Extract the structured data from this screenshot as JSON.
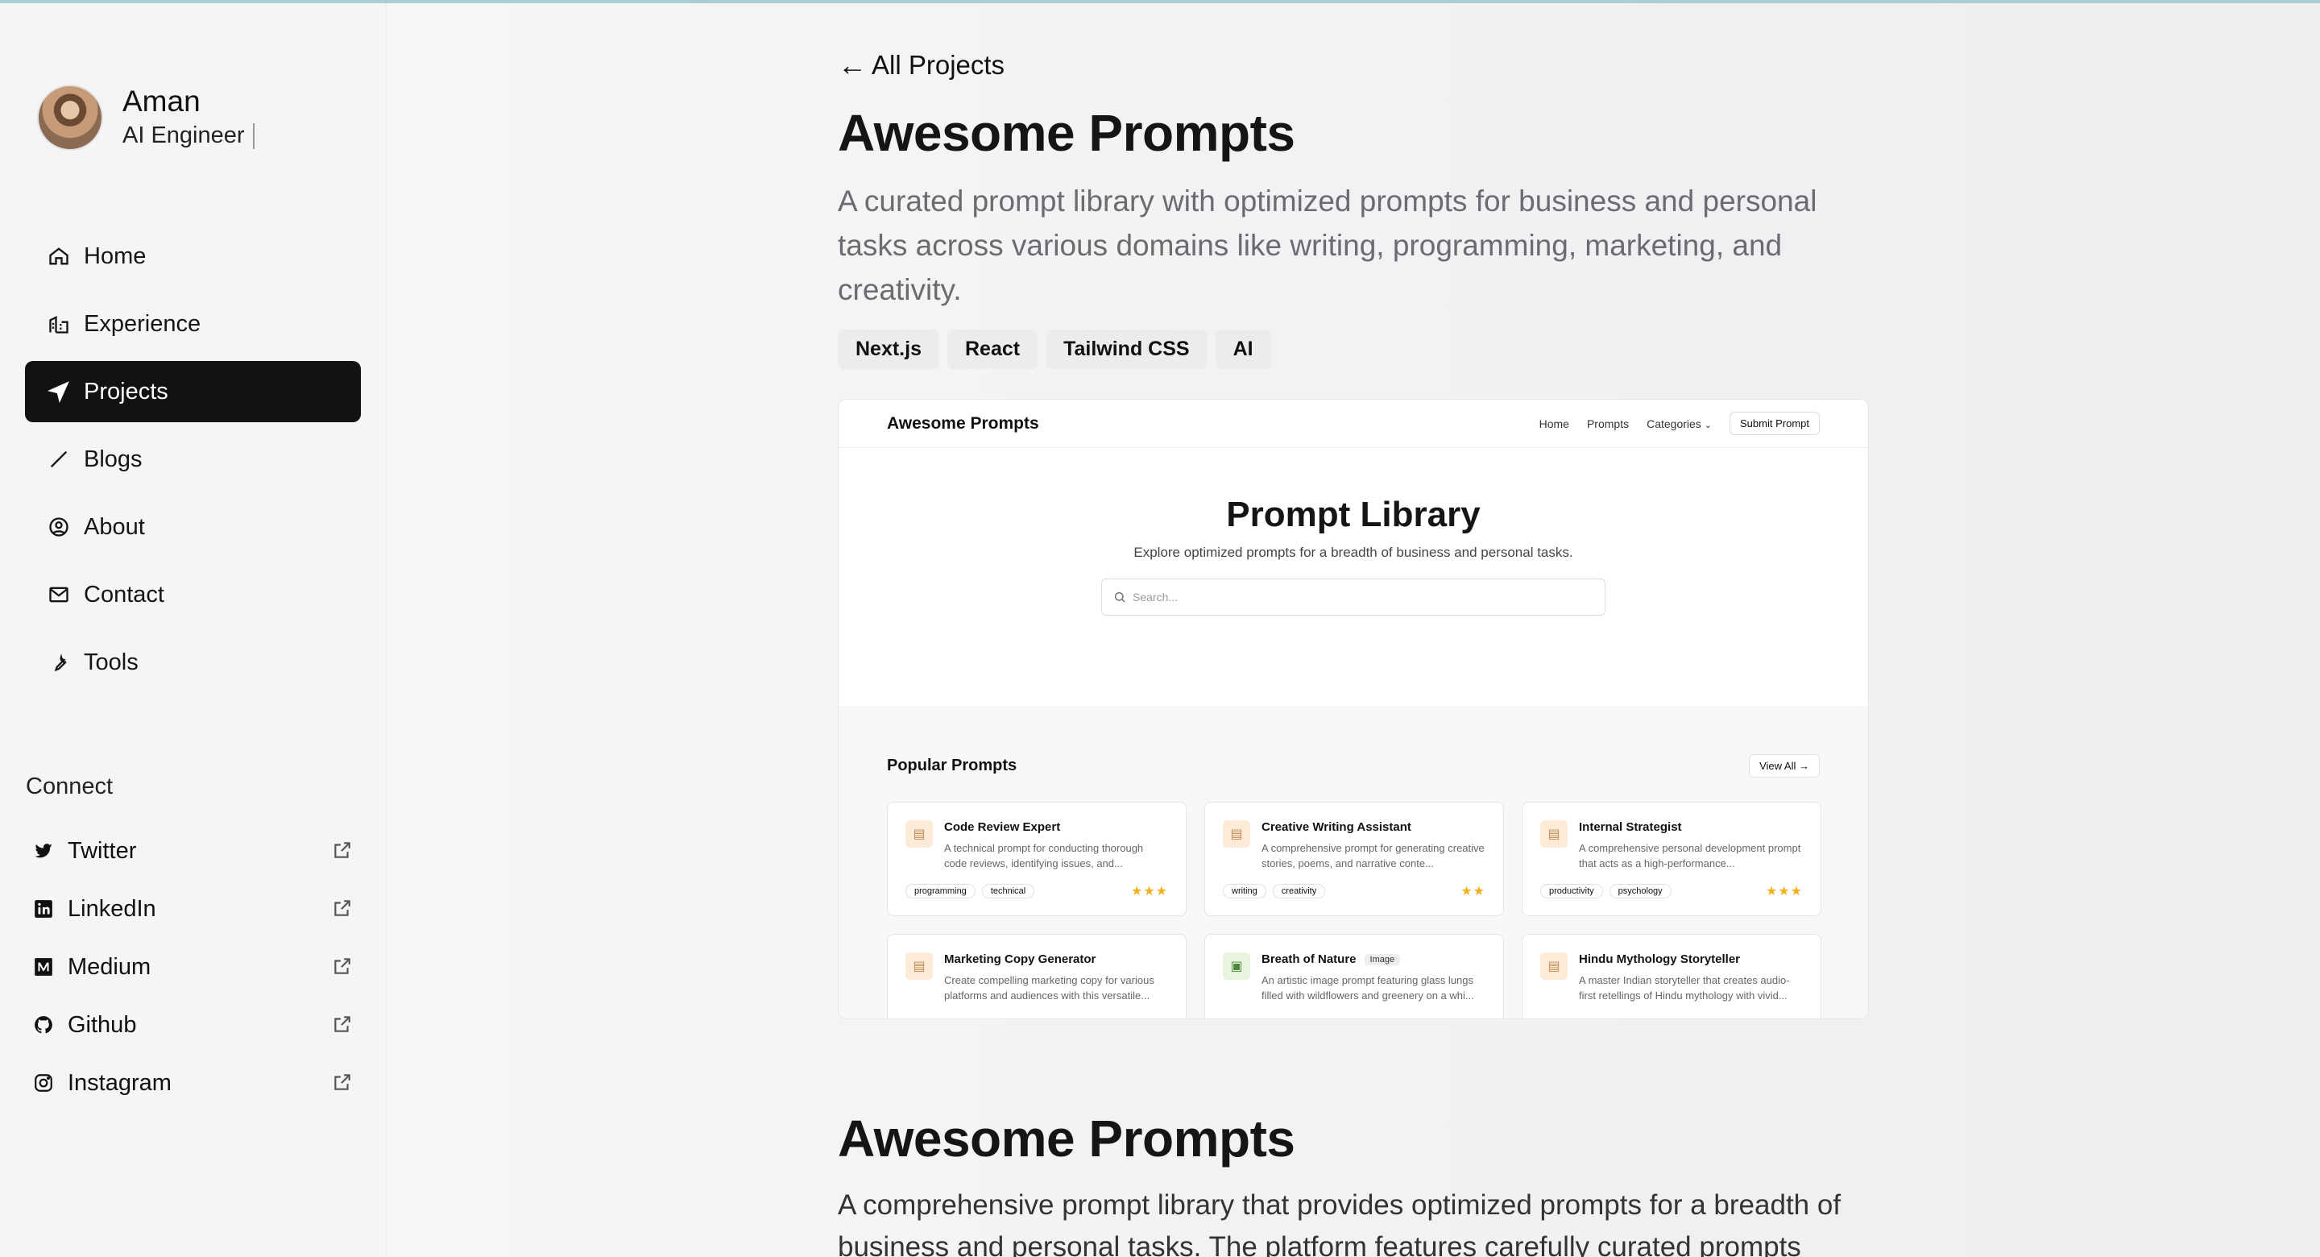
{
  "profile": {
    "name": "Aman",
    "role": "AI Engineer"
  },
  "nav": [
    {
      "label": "Home",
      "icon": "home-icon"
    },
    {
      "label": "Experience",
      "icon": "building-icon"
    },
    {
      "label": "Projects",
      "icon": "navigation-icon",
      "active": true
    },
    {
      "label": "Blogs",
      "icon": "pen-icon"
    },
    {
      "label": "About",
      "icon": "user-circle-icon"
    },
    {
      "label": "Contact",
      "icon": "mail-icon"
    },
    {
      "label": "Tools",
      "icon": "wrench-icon"
    }
  ],
  "connect": {
    "title": "Connect",
    "items": [
      {
        "label": "Twitter",
        "icon": "twitter-icon"
      },
      {
        "label": "LinkedIn",
        "icon": "linkedin-icon"
      },
      {
        "label": "Medium",
        "icon": "medium-icon"
      },
      {
        "label": "Github",
        "icon": "github-icon"
      },
      {
        "label": "Instagram",
        "icon": "instagram-icon"
      }
    ]
  },
  "main": {
    "back": "All Projects",
    "title": "Awesome Prompts",
    "description": "A curated prompt library with optimized prompts for business and personal tasks across various domains like writing, programming, marketing, and creativity.",
    "tags": [
      "Next.js",
      "React",
      "Tailwind CSS",
      "AI"
    ]
  },
  "preview": {
    "brand": "Awesome Prompts",
    "links": {
      "home": "Home",
      "prompts": "Prompts",
      "categories": "Categories",
      "submit": "Submit Prompt"
    },
    "hero_title": "Prompt Library",
    "hero_sub": "Explore optimized prompts for a breadth of business and personal tasks.",
    "search_placeholder": "Search...",
    "popular_title": "Popular Prompts",
    "view_all": "View All",
    "cards": [
      {
        "title": "Code Review Expert",
        "desc": "A technical prompt for conducting thorough code reviews, identifying issues, and...",
        "chips": [
          "programming",
          "technical"
        ],
        "stars": "★★★"
      },
      {
        "title": "Creative Writing Assistant",
        "desc": "A comprehensive prompt for generating creative stories, poems, and narrative conte...",
        "chips": [
          "writing",
          "creativity"
        ],
        "stars": "★★"
      },
      {
        "title": "Internal Strategist",
        "desc": "A comprehensive personal development prompt that acts as a high-performance...",
        "chips": [
          "productivity",
          "psychology"
        ],
        "stars": "★★★"
      },
      {
        "title": "Marketing Copy Generator",
        "desc": "Create compelling marketing copy for various platforms and audiences with this versatile...",
        "chips": [],
        "stars": ""
      },
      {
        "title": "Breath of Nature",
        "badge": "Image",
        "desc": "An artistic image prompt featuring glass lungs filled with wildflowers and greenery on a whi...",
        "chips": [],
        "stars": ""
      },
      {
        "title": "Hindu Mythology Storyteller",
        "desc": "A master Indian storyteller that creates audio-first retellings of Hindu mythology with vivid...",
        "chips": [],
        "stars": ""
      }
    ]
  },
  "section": {
    "title": "Awesome Prompts",
    "text": "A comprehensive prompt library that provides optimized prompts for a breadth of business and personal tasks. The platform features carefully curated prompts"
  },
  "colors": {
    "active_nav_bg": "#121212",
    "accent_stars": "#f2b01e",
    "top_line": "#a9cfd6"
  }
}
